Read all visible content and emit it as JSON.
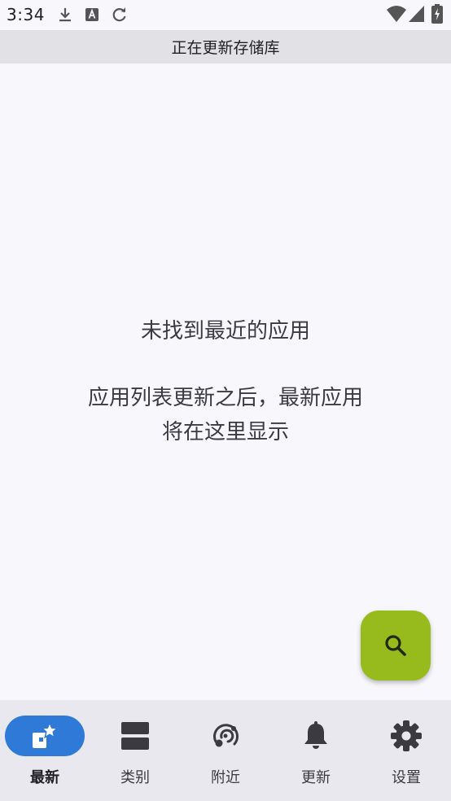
{
  "status_bar": {
    "time": "3:34",
    "left_icons": [
      "download-icon",
      "a-badge-icon",
      "refresh-icon"
    ],
    "right_icons": [
      "wifi-icon",
      "signal-icon",
      "battery-icon"
    ]
  },
  "banner": {
    "text": "正在更新存储库"
  },
  "empty_state": {
    "title": "未找到最近的应用",
    "description_line1": "应用列表更新之后，最新应用",
    "description_line2": "将在这里显示"
  },
  "fab": {
    "icon": "search-icon"
  },
  "nav": {
    "items": [
      {
        "label": "最新",
        "icon": "latest-star-icon",
        "active": true
      },
      {
        "label": "类别",
        "icon": "categories-icon",
        "active": false
      },
      {
        "label": "附近",
        "icon": "nearby-icon",
        "active": false
      },
      {
        "label": "更新",
        "icon": "bell-icon",
        "active": false
      },
      {
        "label": "设置",
        "icon": "gear-icon",
        "active": false
      }
    ]
  },
  "colors": {
    "accent": "#2f7ad6",
    "fab": "#97bb1d",
    "background": "#f8f7fc",
    "banner": "#e2e2e6",
    "nav_background": "#e9e8ee"
  }
}
